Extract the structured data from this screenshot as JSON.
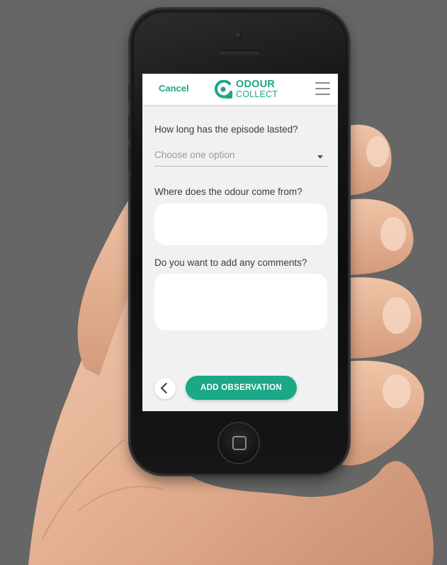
{
  "header": {
    "cancel_label": "Cancel",
    "logo_line1": "ODOUR",
    "logo_line2": "COLLECT",
    "menu_icon": "hamburger-menu-icon"
  },
  "form": {
    "duration": {
      "question": "How long has the episode lasted?",
      "placeholder": "Choose one option"
    },
    "source": {
      "question": "Where does the odour come from?",
      "value": ""
    },
    "comments": {
      "question": "Do you want to add any comments?",
      "value": ""
    }
  },
  "footer": {
    "back_icon": "chevron-left-icon",
    "submit_label": "ADD OBSERVATION"
  },
  "colors": {
    "accent": "#1aa887",
    "screen_background": "#f1f1f1",
    "page_background": "#666666"
  }
}
